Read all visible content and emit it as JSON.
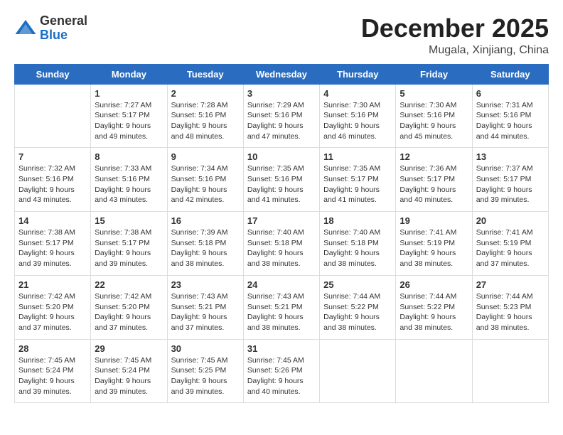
{
  "header": {
    "logo_general": "General",
    "logo_blue": "Blue",
    "month": "December 2025",
    "location": "Mugala, Xinjiang, China"
  },
  "weekdays": [
    "Sunday",
    "Monday",
    "Tuesday",
    "Wednesday",
    "Thursday",
    "Friday",
    "Saturday"
  ],
  "weeks": [
    [
      {
        "day": "",
        "sunrise": "",
        "sunset": "",
        "daylight": ""
      },
      {
        "day": "1",
        "sunrise": "Sunrise: 7:27 AM",
        "sunset": "Sunset: 5:17 PM",
        "daylight": "Daylight: 9 hours and 49 minutes."
      },
      {
        "day": "2",
        "sunrise": "Sunrise: 7:28 AM",
        "sunset": "Sunset: 5:16 PM",
        "daylight": "Daylight: 9 hours and 48 minutes."
      },
      {
        "day": "3",
        "sunrise": "Sunrise: 7:29 AM",
        "sunset": "Sunset: 5:16 PM",
        "daylight": "Daylight: 9 hours and 47 minutes."
      },
      {
        "day": "4",
        "sunrise": "Sunrise: 7:30 AM",
        "sunset": "Sunset: 5:16 PM",
        "daylight": "Daylight: 9 hours and 46 minutes."
      },
      {
        "day": "5",
        "sunrise": "Sunrise: 7:30 AM",
        "sunset": "Sunset: 5:16 PM",
        "daylight": "Daylight: 9 hours and 45 minutes."
      },
      {
        "day": "6",
        "sunrise": "Sunrise: 7:31 AM",
        "sunset": "Sunset: 5:16 PM",
        "daylight": "Daylight: 9 hours and 44 minutes."
      }
    ],
    [
      {
        "day": "7",
        "sunrise": "Sunrise: 7:32 AM",
        "sunset": "Sunset: 5:16 PM",
        "daylight": "Daylight: 9 hours and 43 minutes."
      },
      {
        "day": "8",
        "sunrise": "Sunrise: 7:33 AM",
        "sunset": "Sunset: 5:16 PM",
        "daylight": "Daylight: 9 hours and 43 minutes."
      },
      {
        "day": "9",
        "sunrise": "Sunrise: 7:34 AM",
        "sunset": "Sunset: 5:16 PM",
        "daylight": "Daylight: 9 hours and 42 minutes."
      },
      {
        "day": "10",
        "sunrise": "Sunrise: 7:35 AM",
        "sunset": "Sunset: 5:16 PM",
        "daylight": "Daylight: 9 hours and 41 minutes."
      },
      {
        "day": "11",
        "sunrise": "Sunrise: 7:35 AM",
        "sunset": "Sunset: 5:17 PM",
        "daylight": "Daylight: 9 hours and 41 minutes."
      },
      {
        "day": "12",
        "sunrise": "Sunrise: 7:36 AM",
        "sunset": "Sunset: 5:17 PM",
        "daylight": "Daylight: 9 hours and 40 minutes."
      },
      {
        "day": "13",
        "sunrise": "Sunrise: 7:37 AM",
        "sunset": "Sunset: 5:17 PM",
        "daylight": "Daylight: 9 hours and 39 minutes."
      }
    ],
    [
      {
        "day": "14",
        "sunrise": "Sunrise: 7:38 AM",
        "sunset": "Sunset: 5:17 PM",
        "daylight": "Daylight: 9 hours and 39 minutes."
      },
      {
        "day": "15",
        "sunrise": "Sunrise: 7:38 AM",
        "sunset": "Sunset: 5:17 PM",
        "daylight": "Daylight: 9 hours and 39 minutes."
      },
      {
        "day": "16",
        "sunrise": "Sunrise: 7:39 AM",
        "sunset": "Sunset: 5:18 PM",
        "daylight": "Daylight: 9 hours and 38 minutes."
      },
      {
        "day": "17",
        "sunrise": "Sunrise: 7:40 AM",
        "sunset": "Sunset: 5:18 PM",
        "daylight": "Daylight: 9 hours and 38 minutes."
      },
      {
        "day": "18",
        "sunrise": "Sunrise: 7:40 AM",
        "sunset": "Sunset: 5:18 PM",
        "daylight": "Daylight: 9 hours and 38 minutes."
      },
      {
        "day": "19",
        "sunrise": "Sunrise: 7:41 AM",
        "sunset": "Sunset: 5:19 PM",
        "daylight": "Daylight: 9 hours and 38 minutes."
      },
      {
        "day": "20",
        "sunrise": "Sunrise: 7:41 AM",
        "sunset": "Sunset: 5:19 PM",
        "daylight": "Daylight: 9 hours and 37 minutes."
      }
    ],
    [
      {
        "day": "21",
        "sunrise": "Sunrise: 7:42 AM",
        "sunset": "Sunset: 5:20 PM",
        "daylight": "Daylight: 9 hours and 37 minutes."
      },
      {
        "day": "22",
        "sunrise": "Sunrise: 7:42 AM",
        "sunset": "Sunset: 5:20 PM",
        "daylight": "Daylight: 9 hours and 37 minutes."
      },
      {
        "day": "23",
        "sunrise": "Sunrise: 7:43 AM",
        "sunset": "Sunset: 5:21 PM",
        "daylight": "Daylight: 9 hours and 37 minutes."
      },
      {
        "day": "24",
        "sunrise": "Sunrise: 7:43 AM",
        "sunset": "Sunset: 5:21 PM",
        "daylight": "Daylight: 9 hours and 38 minutes."
      },
      {
        "day": "25",
        "sunrise": "Sunrise: 7:44 AM",
        "sunset": "Sunset: 5:22 PM",
        "daylight": "Daylight: 9 hours and 38 minutes."
      },
      {
        "day": "26",
        "sunrise": "Sunrise: 7:44 AM",
        "sunset": "Sunset: 5:22 PM",
        "daylight": "Daylight: 9 hours and 38 minutes."
      },
      {
        "day": "27",
        "sunrise": "Sunrise: 7:44 AM",
        "sunset": "Sunset: 5:23 PM",
        "daylight": "Daylight: 9 hours and 38 minutes."
      }
    ],
    [
      {
        "day": "28",
        "sunrise": "Sunrise: 7:45 AM",
        "sunset": "Sunset: 5:24 PM",
        "daylight": "Daylight: 9 hours and 39 minutes."
      },
      {
        "day": "29",
        "sunrise": "Sunrise: 7:45 AM",
        "sunset": "Sunset: 5:24 PM",
        "daylight": "Daylight: 9 hours and 39 minutes."
      },
      {
        "day": "30",
        "sunrise": "Sunrise: 7:45 AM",
        "sunset": "Sunset: 5:25 PM",
        "daylight": "Daylight: 9 hours and 39 minutes."
      },
      {
        "day": "31",
        "sunrise": "Sunrise: 7:45 AM",
        "sunset": "Sunset: 5:26 PM",
        "daylight": "Daylight: 9 hours and 40 minutes."
      },
      {
        "day": "",
        "sunrise": "",
        "sunset": "",
        "daylight": ""
      },
      {
        "day": "",
        "sunrise": "",
        "sunset": "",
        "daylight": ""
      },
      {
        "day": "",
        "sunrise": "",
        "sunset": "",
        "daylight": ""
      }
    ]
  ]
}
